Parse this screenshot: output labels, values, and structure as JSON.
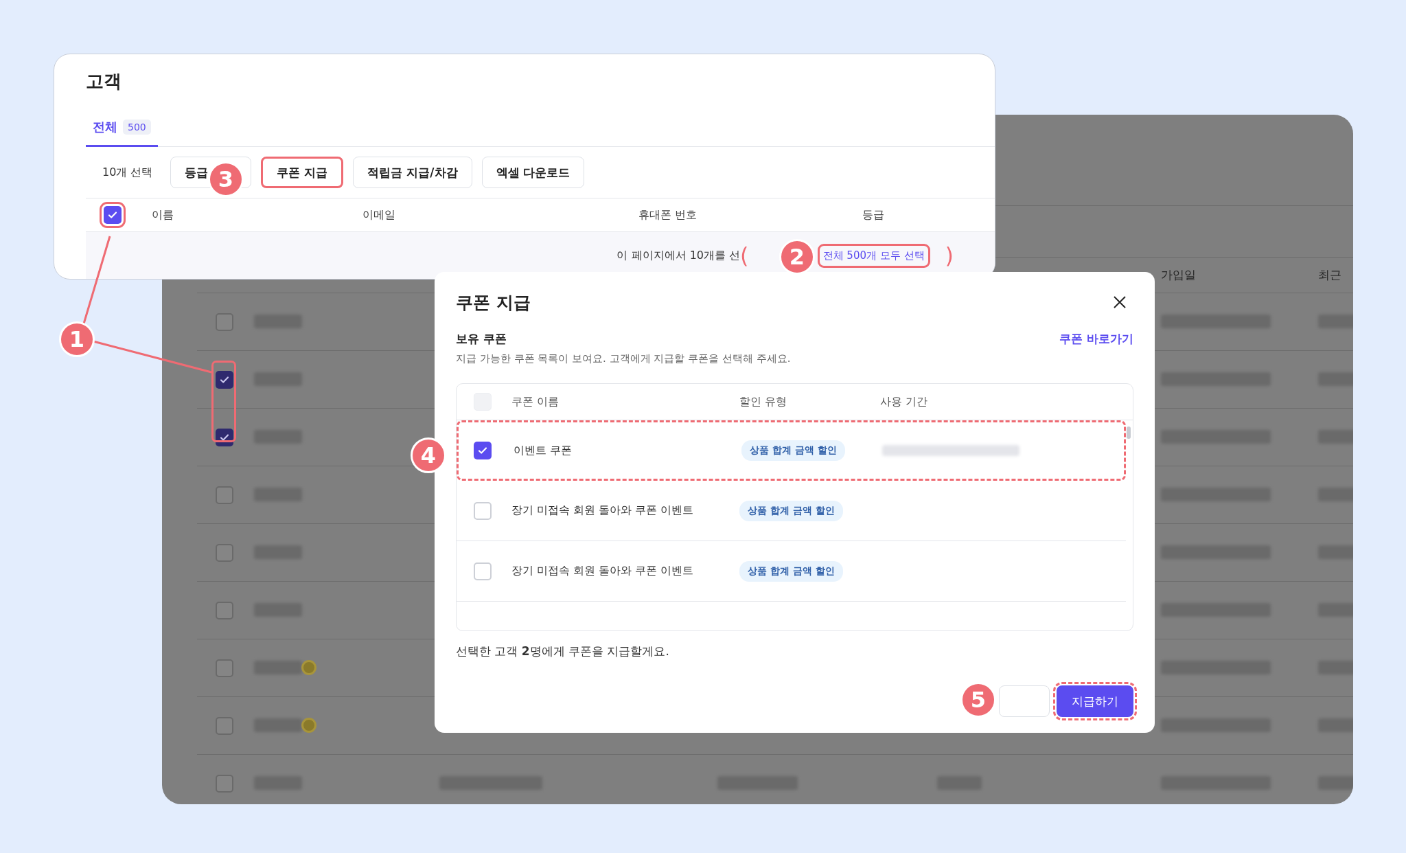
{
  "background_table": {
    "columns": [
      "가입일",
      "최근"
    ],
    "rows": [
      {
        "checked": false,
        "grade_icon": false
      },
      {
        "checked": true,
        "grade_icon": false
      },
      {
        "checked": true,
        "grade_icon": false
      },
      {
        "checked": false,
        "grade_icon": false
      },
      {
        "checked": false,
        "grade_icon": false
      },
      {
        "checked": false,
        "grade_icon": false
      },
      {
        "checked": false,
        "grade_icon": true
      },
      {
        "checked": false,
        "grade_icon": true
      },
      {
        "checked": false,
        "grade_icon": false
      }
    ]
  },
  "customers_card": {
    "title": "고객",
    "tabs": [
      {
        "label": "전체",
        "count": "500",
        "selected": true
      }
    ],
    "selection_count": "10개 선택",
    "actions": [
      {
        "label": "등급",
        "highlighted": false
      },
      {
        "label": "쿠폰 지급",
        "highlighted": true
      },
      {
        "label": "적립금 지급/차감",
        "highlighted": false
      },
      {
        "label": "엑셀 다운로드",
        "highlighted": false
      }
    ],
    "select_all_checked": true,
    "columns": [
      "이름",
      "이메일",
      "휴대폰 번호",
      "등급"
    ],
    "banner": {
      "text": "이 페이지에서 10개를 선",
      "link": "전체 500개 모두 선택",
      "open_bracket": "(",
      "close_bracket": ")"
    }
  },
  "coupon_dialog": {
    "title": "쿠폰 지급",
    "section_title": "보유 쿠폰",
    "description": "지급 가능한 쿠폰 목록이 보여요. 고객에게 지급할 쿠폰을 선택해 주세요.",
    "link": "쿠폰 바로가기",
    "select_all_disabled": true,
    "columns": [
      "쿠폰 이름",
      "할인 유형",
      "사용 기간"
    ],
    "rows": [
      {
        "name": "이벤트 쿠폰",
        "type": "상품 합계 금액 할인",
        "checked": true,
        "highlighted": true,
        "period_blurred": true
      },
      {
        "name": "장기 미접속 회원 돌아와 쿠폰 이벤트",
        "type": "상품 합계 금액 할인",
        "checked": false,
        "highlighted": false,
        "period_blurred": false
      },
      {
        "name": "장기 미접속 회원 돌아와 쿠폰 이벤트",
        "type": "상품 합계 금액 할인",
        "checked": false,
        "highlighted": false,
        "period_blurred": false
      }
    ],
    "summary": "선택한 고객 **2**명에게 쿠폰을 지급할게요.",
    "buttons": [
      {
        "kind": "secondary",
        "highlighted": false
      },
      {
        "kind": "primary",
        "label": "지급하기",
        "highlighted": true
      }
    ]
  },
  "annotations": [
    "1",
    "2",
    "3",
    "4",
    "5"
  ]
}
